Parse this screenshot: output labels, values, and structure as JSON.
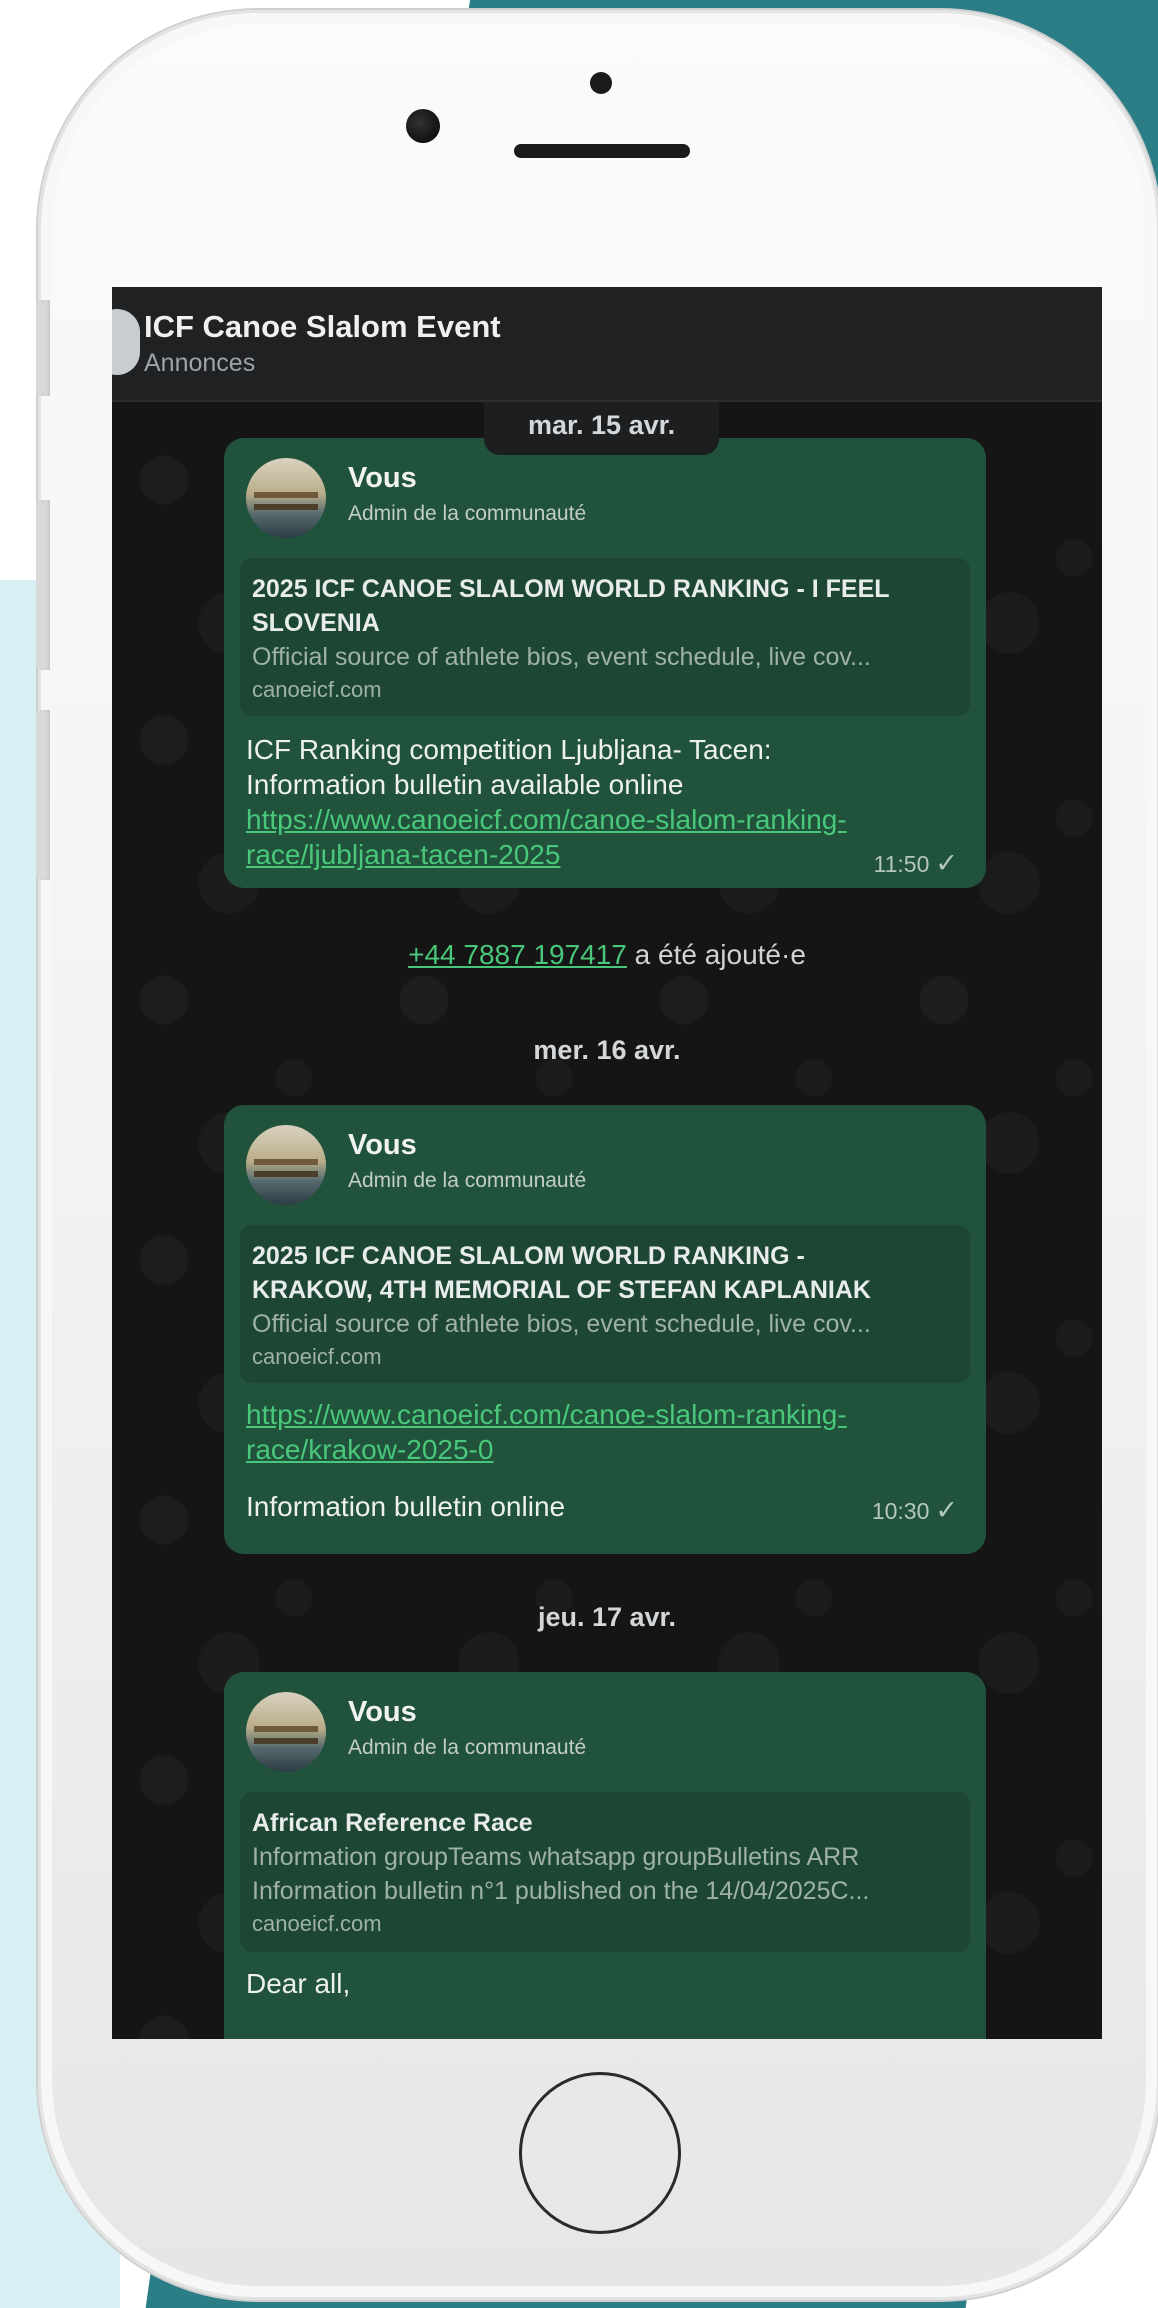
{
  "header": {
    "title": "ICF Canoe Slalom Event",
    "subtitle": "Annonces"
  },
  "dates": [
    "mar. 15 avr.",
    "mer. 16 avr.",
    "jeu. 17 avr."
  ],
  "messages": [
    {
      "sender": "Vous",
      "role": "Admin de la communauté",
      "preview": {
        "title_line1": "2025 ICF CANOE SLALOM WORLD RANKING - I FEEL",
        "title_line2": "SLOVENIA",
        "description": "Official source of athlete bios, event schedule, live cov...",
        "domain": "canoeicf.com"
      },
      "text_line1": "ICF Ranking competition Ljubljana- Tacen:",
      "text_line2": "Information bulletin available online",
      "link_line1": "https://www.canoeicf.com/canoe-slalom-ranking-",
      "link_line2": "race/ljubljana-tacen-2025",
      "time": "11:50"
    },
    {
      "sender": "Vous",
      "role": "Admin de la communauté",
      "preview": {
        "title_line1": "2025 ICF CANOE SLALOM WORLD RANKING -",
        "title_line2": "KRAKOW, 4TH MEMORIAL OF STEFAN KAPLANIAK",
        "description": "Official source of athlete bios, event schedule, live cov...",
        "domain": "canoeicf.com"
      },
      "link_line1": "https://www.canoeicf.com/canoe-slalom-ranking-",
      "link_line2": "race/krakow-2025-0",
      "text_line1": "Information bulletin online",
      "time": "10:30"
    },
    {
      "sender": "Vous",
      "role": "Admin de la communauté",
      "preview": {
        "title_line1": "African Reference Race",
        "desc_line1": "Information groupTeams whatsapp groupBulletins ARR",
        "desc_line2": "Information bulletin n°1 published on the 14/04/2025C...",
        "domain": "canoeicf.com"
      },
      "text_line1": "Dear all,"
    }
  ],
  "system": {
    "phone": "+44 7887 197417",
    "suffix": " a été ajouté·e"
  },
  "icons": {
    "tick": "✓"
  }
}
